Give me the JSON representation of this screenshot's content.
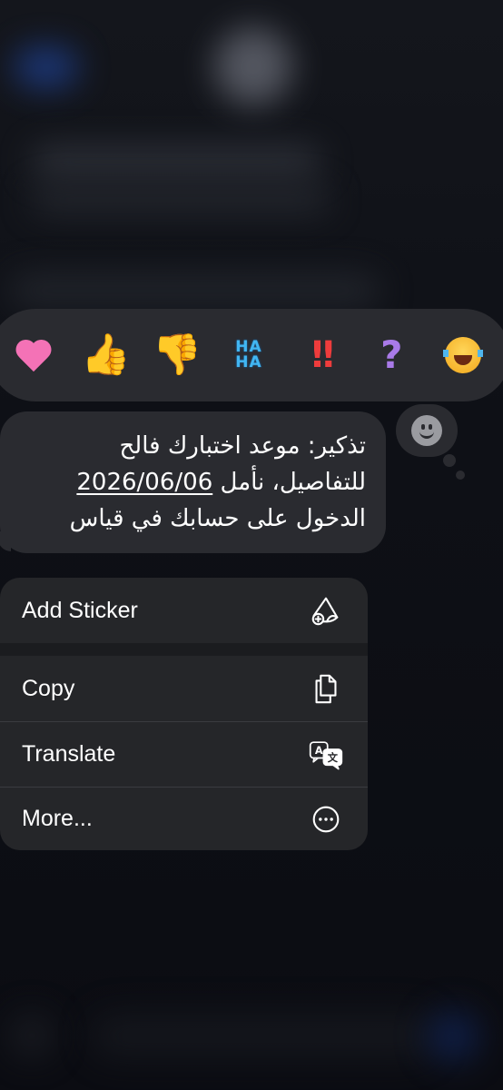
{
  "reactions": [
    {
      "name": "heart",
      "glyph": "heart",
      "color": "#f472b6"
    },
    {
      "name": "thumbs-up",
      "glyph": "👍"
    },
    {
      "name": "thumbs-down",
      "glyph": "👎"
    },
    {
      "name": "haha",
      "text_top": "HA",
      "text_bottom": "HA",
      "color": "#41b6f2"
    },
    {
      "name": "double-exclamation",
      "glyph": "!!",
      "color": "#ee3c3c"
    },
    {
      "name": "question",
      "glyph": "?",
      "color": "#a97ae8"
    },
    {
      "name": "laughing-with-tears",
      "glyph": "laugh-emoji"
    }
  ],
  "message": {
    "line1": "تذكير: موعد اختبارك فالح",
    "line2_date": "2026/06/06",
    "line2_rest": " للتفاصيل، نأمل",
    "line3": "الدخول على حسابك في قياس"
  },
  "menu": {
    "items": [
      {
        "label": "Add Sticker",
        "icon": "sticker-icon"
      },
      {
        "label": "Copy",
        "icon": "copy-icon"
      },
      {
        "label": "Translate",
        "icon": "translate-icon"
      },
      {
        "label": "More...",
        "icon": "more-icon"
      }
    ]
  },
  "colors": {
    "surface": "#2a2b30",
    "menu_surface": "#252629",
    "background": "#0a0b10"
  }
}
